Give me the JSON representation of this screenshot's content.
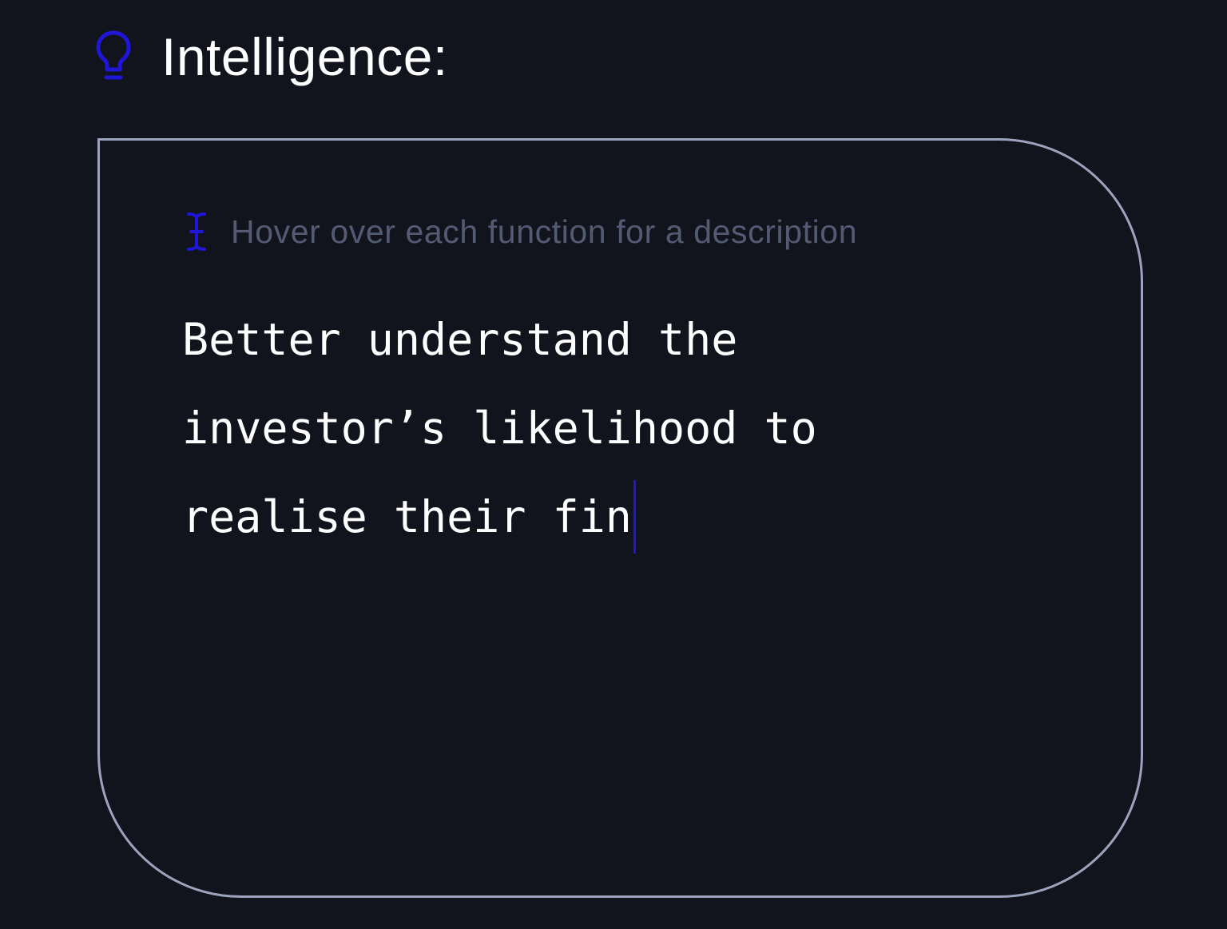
{
  "header": {
    "icon": "lightbulb-icon",
    "title": "Intelligence:"
  },
  "card": {
    "hint": {
      "icon": "text-cursor-icon",
      "text": "Hover over each function for a description"
    },
    "typed_lines": [
      "Better understand the",
      "investor’s likelihood to",
      "realise their fin"
    ]
  },
  "colors": {
    "background": "#12141d",
    "accent": "#1f16d8",
    "border": "#9ea3bd",
    "hint_text": "#535b73",
    "text": "#ffffff"
  }
}
